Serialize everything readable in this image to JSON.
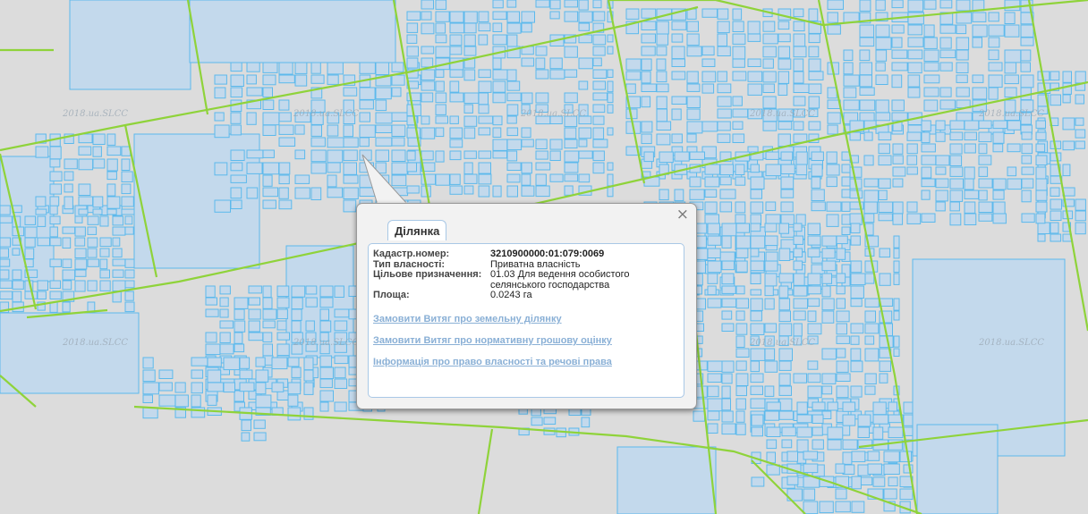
{
  "map": {
    "watermark": "2018.ua.SLCC",
    "colors": {
      "background": "#dcdcdc",
      "parcel_fill": "#c3d9ec",
      "parcel_stroke": "#5cb9ec",
      "boundary": "#8fd33a"
    }
  },
  "popup": {
    "tab_label": "Ділянка",
    "close_glyph": "×",
    "fields": [
      {
        "label": "Кадастр.номер:",
        "value": "3210900000:01:079:0069"
      },
      {
        "label": "Тип власності:",
        "value": "Приватна власність"
      },
      {
        "label": "Цільове призначення:",
        "value": "01.03 Для ведення особистого селянського господарства"
      },
      {
        "label": "Площа:",
        "value": "0.0243 га"
      }
    ],
    "links": [
      "Замовити Витяг про земельну ділянку",
      "Замовити Витяг про нормативну грошову оцінку",
      "Інформація про право власності та речові права"
    ]
  }
}
